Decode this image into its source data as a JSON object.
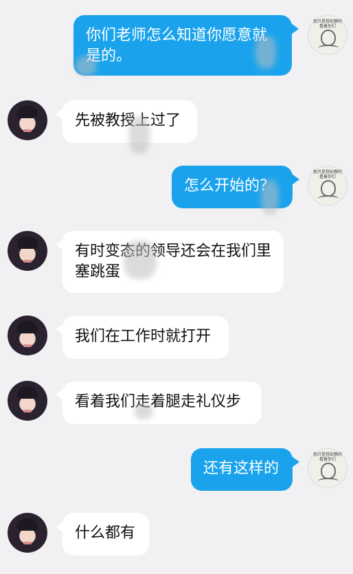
{
  "messages": [
    {
      "side": "out",
      "text": "你们老师怎么知道你愿意就是的。"
    },
    {
      "side": "in",
      "text": "先被教授上过了"
    },
    {
      "side": "out",
      "text": "怎么开始的？"
    },
    {
      "side": "in",
      "text": "有时变态的领导还会在我们里塞跳蛋"
    },
    {
      "side": "in",
      "text": "我们在工作时就打开"
    },
    {
      "side": "in",
      "text": "看着我们走着腿走礼仪步"
    },
    {
      "side": "out",
      "text": "还有这样的"
    },
    {
      "side": "in",
      "text": "什么都有"
    }
  ],
  "self_avatar": {
    "caption": "我只是想安静的看着你们"
  },
  "colors": {
    "background": "#f1f1f3",
    "outgoing_bubble": "#1aa3ec",
    "incoming_bubble": "#ffffff"
  }
}
